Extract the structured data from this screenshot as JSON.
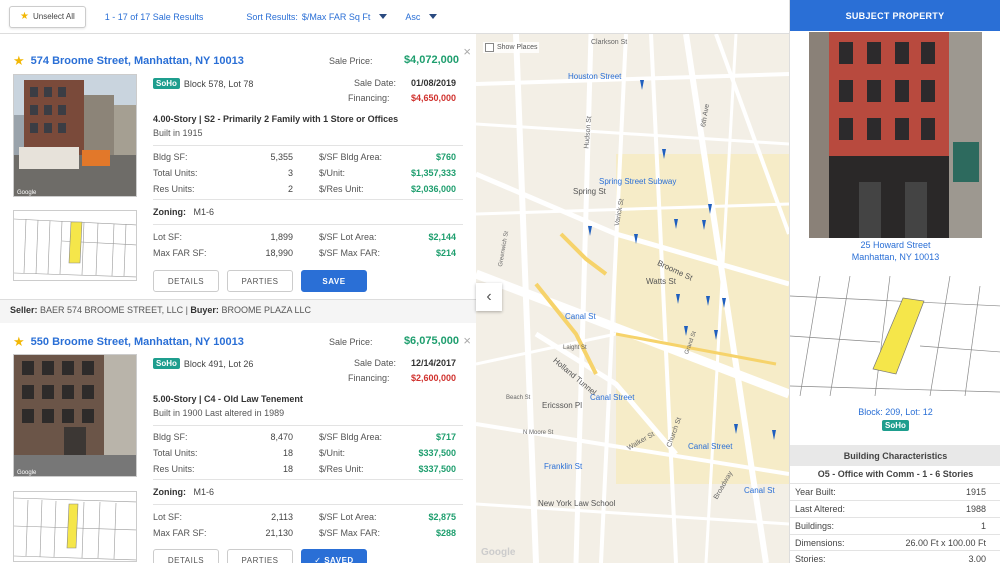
{
  "toolbar": {
    "unselect_label": "Unselect All",
    "results_count": "1 - 17 of 17 Sale Results",
    "sort_label": "Sort Results:",
    "sort_value": "$/Max FAR Sq Ft",
    "order_value": "Asc"
  },
  "listings": [
    {
      "title": "574 Broome Street, Manhattan, NY 10013",
      "sale_price_label": "Sale Price:",
      "sale_price": "$4,072,000",
      "sale_date_label": "Sale Date:",
      "sale_date": "01/08/2019",
      "financing_label": "Financing:",
      "financing": "$4,650,000",
      "district": "SoHo",
      "block_lot": "Block 578, Lot 78",
      "description": "4.00-Story | S2 - Primarily 2 Family with 1 Store or Offices",
      "built": "Built in 1915",
      "stats": [
        {
          "l1": "Bldg SF:",
          "v1": "5,355",
          "l2": "$/SF Bldg Area:",
          "v2": "$760"
        },
        {
          "l1": "Total Units:",
          "v1": "3",
          "l2": "$/Unit:",
          "v2": "$1,357,333"
        },
        {
          "l1": "Res Units:",
          "v1": "2",
          "l2": "$/Res Unit:",
          "v2": "$2,036,000"
        }
      ],
      "zoning_label": "Zoning:",
      "zoning": "M1-6",
      "lot_stats": [
        {
          "l1": "Lot SF:",
          "v1": "1,899",
          "l2": "$/SF Lot Area:",
          "v2": "$2,144"
        },
        {
          "l1": "Max FAR SF:",
          "v1": "18,990",
          "l2": "$/SF Max FAR:",
          "v2": "$214"
        }
      ],
      "details_label": "DETAILS",
      "parties_label": "PARTIES",
      "save_label": "SAVE",
      "seller_label": "Seller:",
      "seller": "BAER 574 BROOME STREET, LLC",
      "buyer_label": "Buyer:",
      "buyer": "BROOME PLAZA LLC"
    },
    {
      "title": "550 Broome Street, Manhattan, NY 10013",
      "sale_price_label": "Sale Price:",
      "sale_price": "$6,075,000",
      "sale_date_label": "Sale Date:",
      "sale_date": "12/14/2017",
      "financing_label": "Financing:",
      "financing": "$2,600,000",
      "district": "SoHo",
      "block_lot": "Block 491, Lot 26",
      "description": "5.00-Story | C4 - Old Law Tenement",
      "built": "Built in 1900 Last altered in 1989",
      "stats": [
        {
          "l1": "Bldg SF:",
          "v1": "8,470",
          "l2": "$/SF Bldg Area:",
          "v2": "$717"
        },
        {
          "l1": "Total Units:",
          "v1": "18",
          "l2": "$/Unit:",
          "v2": "$337,500"
        },
        {
          "l1": "Res Units:",
          "v1": "18",
          "l2": "$/Res Unit:",
          "v2": "$337,500"
        }
      ],
      "zoning_label": "Zoning:",
      "zoning": "M1-6",
      "lot_stats": [
        {
          "l1": "Lot SF:",
          "v1": "2,113",
          "l2": "$/SF Lot Area:",
          "v2": "$2,875"
        },
        {
          "l1": "Max FAR SF:",
          "v1": "21,130",
          "l2": "$/SF Max FAR:",
          "v2": "$288"
        }
      ],
      "details_label": "DETAILS",
      "parties_label": "PARTIES",
      "save_label": "✓ SAVED"
    }
  ],
  "map": {
    "show_places": "Show Places",
    "labels": [
      {
        "text": "Clarkson St"
      },
      {
        "text": "Houston Street"
      },
      {
        "text": "Spring Street Subway"
      },
      {
        "text": "Spring St"
      },
      {
        "text": "Canal St"
      },
      {
        "text": "Canal Street"
      },
      {
        "text": "Canal Street"
      },
      {
        "text": "Canal St"
      },
      {
        "text": "Franklin St"
      },
      {
        "text": "New York Law School"
      },
      {
        "text": "Hudson St"
      },
      {
        "text": "Varick St"
      },
      {
        "text": "Broome St"
      },
      {
        "text": "Watts St"
      },
      {
        "text": "Broadway"
      },
      {
        "text": "6th Ave"
      },
      {
        "text": "Ericsson Pl"
      },
      {
        "text": "Beach St"
      },
      {
        "text": "Walker St"
      },
      {
        "text": "Church St"
      },
      {
        "text": "Greenwich St"
      },
      {
        "text": "Grand St"
      },
      {
        "text": "Laight St"
      },
      {
        "text": "N Moore St"
      },
      {
        "text": "Holland Tunnel"
      },
      {
        "text": "Google"
      }
    ]
  },
  "subject": {
    "header": "SUBJECT PROPERTY",
    "address_line1": "25 Howard Street",
    "address_line2": "Manhattan, NY 10013",
    "block_lot": "Block: 209, Lot: 12",
    "district": "SoHo",
    "characteristics_header": "Building Characteristics",
    "class": "O5 - Office with Comm - 1 - 6 Stories",
    "rows": [
      {
        "label": "Year Built:",
        "value": "1915"
      },
      {
        "label": "Last Altered:",
        "value": "1988"
      },
      {
        "label": "Buildings:",
        "value": "1"
      },
      {
        "label": "Dimensions:",
        "value": "26.00 Ft x 100.00 Ft"
      },
      {
        "label": "Stories:",
        "value": "3.00"
      }
    ]
  },
  "colors": {
    "accent": "#2a6fd6",
    "soho_badge": "#1e9e8e",
    "price_green": "#1e9e6e",
    "financing_red": "#d0312d"
  }
}
